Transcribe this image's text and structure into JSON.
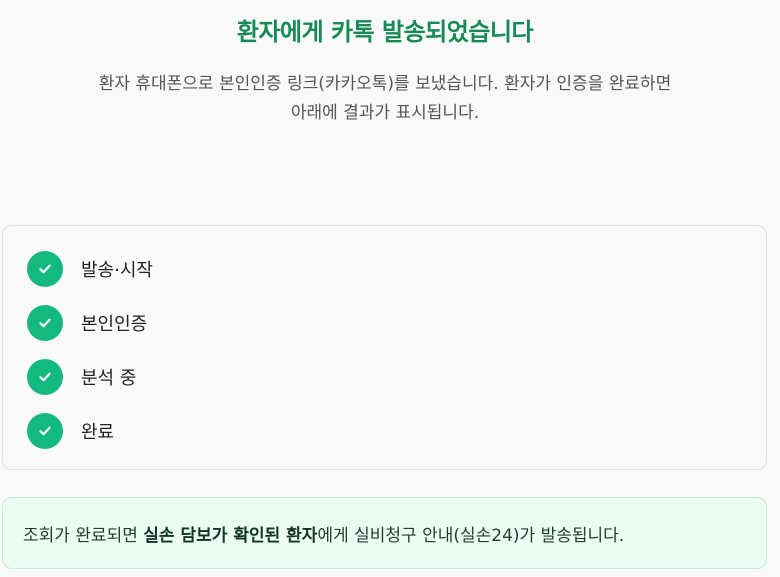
{
  "header": {
    "title": "환자에게 카톡 발송되었습니다",
    "description_line1": "환자 휴대폰으로 본인인증 링크(카카오톡)를 보냈습니다. 환자가 인증을 완료하면",
    "description_line2": "아래에 결과가 표시됩니다."
  },
  "steps": [
    {
      "label": "발송·시작",
      "status": "done",
      "icon": "check-icon"
    },
    {
      "label": "본인인증",
      "status": "done",
      "icon": "check-icon"
    },
    {
      "label": "분석 중",
      "status": "done",
      "icon": "check-icon"
    },
    {
      "label": "완료",
      "status": "done",
      "icon": "check-icon"
    }
  ],
  "notice": {
    "prefix": "조회가 완료되면 ",
    "emphasis": "실손 담보가 확인된 환자",
    "suffix": "에게 실비청구 안내(실손24)가 발송됩니다."
  },
  "colors": {
    "accent": "#168a55",
    "check_bg": "#13b97e",
    "notice_bg": "#ebfcf3"
  }
}
